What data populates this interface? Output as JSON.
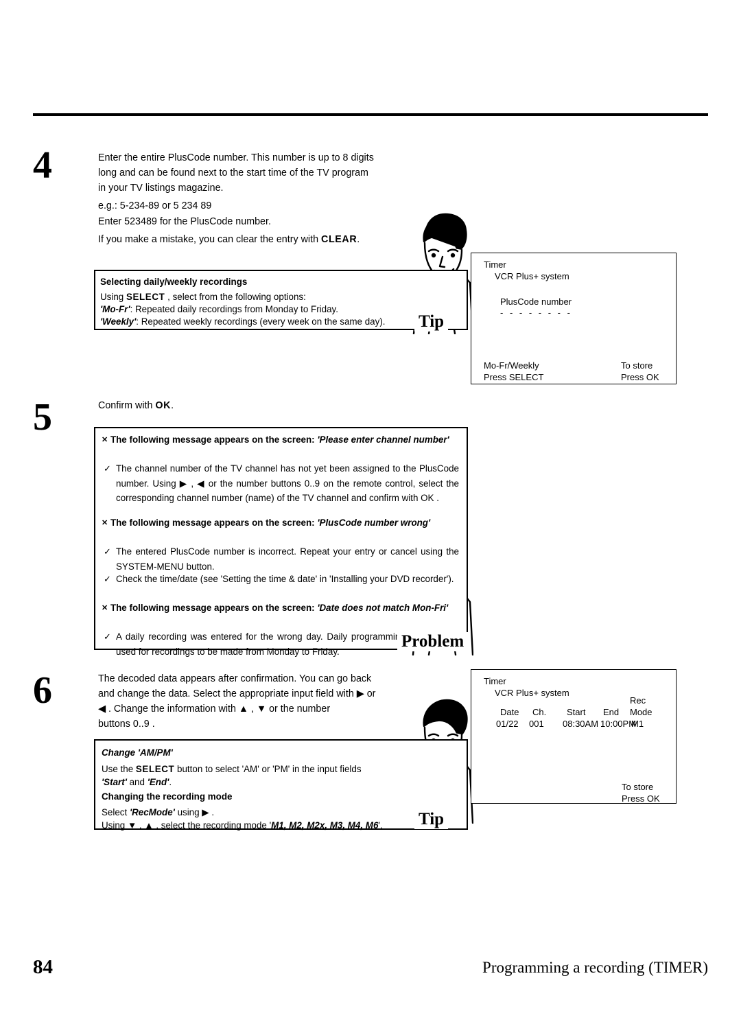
{
  "page": {
    "number": "84",
    "footer_title": "Programming a recording (TIMER)"
  },
  "steps": [
    {
      "number": "4",
      "lines": [
        "Enter the entire PlusCode number. This number is up to 8 digits",
        "long and can be found next to the start time of the TV program",
        "in your TV listings magazine.",
        "e.g.: 5-234-89 or 5 234 89",
        "Enter 523489 for the PlusCode number."
      ],
      "clear_line_pre": "If you make a mistake, you can clear the entry with ",
      "clear_button": "CLEAR",
      "clear_line_post": "."
    },
    {
      "number": "5",
      "confirm_pre": "Confirm with ",
      "confirm_button": "OK",
      "confirm_post": "."
    },
    {
      "number": "6",
      "lines": [
        "The decoded data appears after confirmation. You can go back",
        "and change the data. Select the appropriate input field with  ▶  or",
        "◀ .  Change  the  information  with  ▲ ,  ▼ or  the  number",
        "buttons  0..9 ."
      ]
    }
  ],
  "tip_box_1": {
    "label": "Tip",
    "heading": "Selecting daily/weekly recordings",
    "line1_pre": "Using  ",
    "line1_btn": "SELECT",
    "line1_post": " , select from the following options:",
    "line2_term": "'Mo-Fr'",
    "line2_rest": ": Repeated daily recordings from Monday to Friday.",
    "line3_term": "'Weekly'",
    "line3_rest": ": Repeated weekly recordings (every week on the same day)."
  },
  "problem_box": {
    "label": "Problem",
    "entries": [
      {
        "heading_pre": "The following message appears on the screen: ",
        "heading_msg": "'Please enter channel number'",
        "items": [
          "The channel number of the TV channel has not yet been assigned to the PlusCode number. Using ▶ , ◀ or the number buttons 0..9 on the remote control, select the corresponding channel number (name) of the TV channel and confirm with OK ."
        ]
      },
      {
        "heading_pre": "The following message appears on the screen: ",
        "heading_msg": "'PlusCode number wrong'",
        "items": [
          "The entered PlusCode number is incorrect. Repeat your entry or cancel using the SYSTEM-MENU button.",
          "Check the time/date (see 'Setting the time & date' in 'Installing your DVD recorder')."
        ]
      },
      {
        "heading_pre": "The following message appears on the screen: ",
        "heading_msg": "'Date does not match Mon-Fri'",
        "items": [
          "A daily recording was entered for the wrong day. Daily programming can only be used for recordings to be made from Monday to Friday."
        ]
      }
    ]
  },
  "tip_box_2": {
    "label": "Tip",
    "heading1": "Change 'AM/PM'",
    "line1_a": "Use  the  ",
    "line1_btn": "SELECT",
    "line1_b": " button  to  select  'AM'  or  'PM'  in  the  input  fields",
    "line2_a": "'Start'",
    "line2_b": " and ",
    "line2_c": "'End'",
    "line2_d": ".",
    "heading2": "Changing the recording mode",
    "line3_a": "Select ",
    "line3_b": "'RecMode'",
    "line3_c": " using ▶ .",
    "line4_a": "Using ▼ , ▲ , select the recording mode '",
    "line4_modes": "M1, M2, M2x, M3, M4, M6",
    "line4_b": "'."
  },
  "tv_screen_1": {
    "title": "Timer",
    "subtitle": "VCR Plus+ system",
    "field_label": "PlusCode number",
    "field_value": "- - - - - - - -",
    "left_line1": "Mo-Fr/Weekly",
    "left_line2": "Press SELECT",
    "right_line1": "To store",
    "right_line2": "Press OK"
  },
  "tv_screen_2": {
    "title": "Timer",
    "subtitle": "VCR Plus+ system",
    "rec_label": "Rec",
    "headers": [
      "Date",
      "Ch.",
      "Start",
      "End",
      "Mode"
    ],
    "row": [
      "01/22",
      "001",
      "08:30AM",
      "10:00PM",
      "M1"
    ],
    "right_line1": "To store",
    "right_line2": "Press OK"
  }
}
